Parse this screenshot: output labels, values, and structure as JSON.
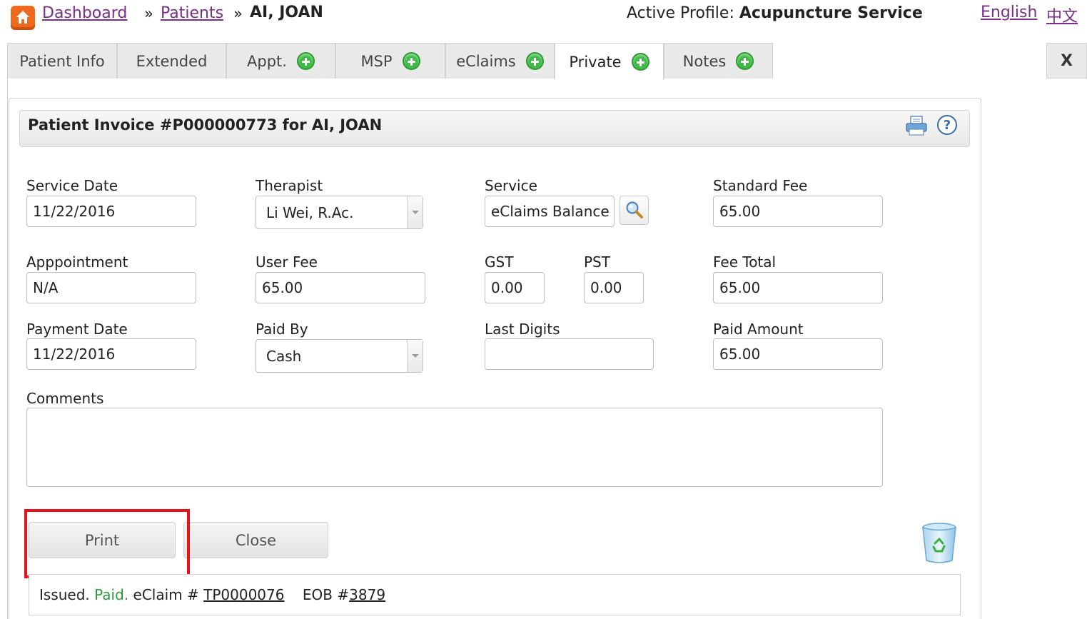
{
  "breadcrumb": {
    "home_icon": "home-icon",
    "dashboard": "Dashboard",
    "sep1": "»",
    "patients": "Patients",
    "sep2": "»",
    "current": "AI, JOAN"
  },
  "profile": {
    "label": "Active Profile: ",
    "name": "Acupuncture Service"
  },
  "languages": {
    "english": "English",
    "chinese": "中文"
  },
  "tabs": [
    {
      "label": "Patient Info",
      "has_add": false,
      "active": false
    },
    {
      "label": "Extended",
      "has_add": false,
      "active": false
    },
    {
      "label": "Appt.",
      "has_add": true,
      "active": false
    },
    {
      "label": "MSP",
      "has_add": true,
      "active": false
    },
    {
      "label": "eClaims",
      "has_add": true,
      "active": false
    },
    {
      "label": "Private",
      "has_add": true,
      "active": true
    },
    {
      "label": "Notes",
      "has_add": true,
      "active": false
    }
  ],
  "close_tab": "X",
  "panel": {
    "title": "Patient Invoice #P000000773 for AI, JOAN",
    "icons": [
      "printer-icon",
      "help-icon"
    ],
    "help_glyph": "?"
  },
  "form": {
    "service_date": {
      "label": "Service Date",
      "value": "11/22/2016"
    },
    "therapist": {
      "label": "Therapist",
      "value": "Li Wei, R.Ac."
    },
    "service": {
      "label": "Service",
      "value": "eClaims Balance"
    },
    "standard_fee": {
      "label": "Standard Fee",
      "value": "65.00"
    },
    "appointment": {
      "label": "Apppointment",
      "value": "N/A"
    },
    "user_fee": {
      "label": "User Fee",
      "value": "65.00"
    },
    "gst": {
      "label": "GST",
      "value": "0.00"
    },
    "pst": {
      "label": "PST",
      "value": "0.00"
    },
    "fee_total": {
      "label": "Fee Total",
      "value": "65.00"
    },
    "payment_date": {
      "label": "Payment Date",
      "value": "11/22/2016"
    },
    "paid_by": {
      "label": "Paid By",
      "value": "Cash"
    },
    "last_digits": {
      "label": "Last Digits",
      "value": ""
    },
    "paid_amount": {
      "label": "Paid Amount",
      "value": "65.00"
    },
    "comments": {
      "label": "Comments",
      "value": ""
    }
  },
  "buttons": {
    "print": "Print",
    "close": "Close"
  },
  "status": {
    "issued": "Issued. ",
    "paid": "Paid.",
    "eclaim_label": " eClaim # ",
    "eclaim_number": "TP0000076",
    "eob_label": "    EOB #",
    "eob_number": "3879"
  },
  "colors": {
    "link": "#7a2d8a",
    "paid": "#2e9a3a",
    "highlight": "#e8131b",
    "add_icon": "#3dbb45"
  }
}
